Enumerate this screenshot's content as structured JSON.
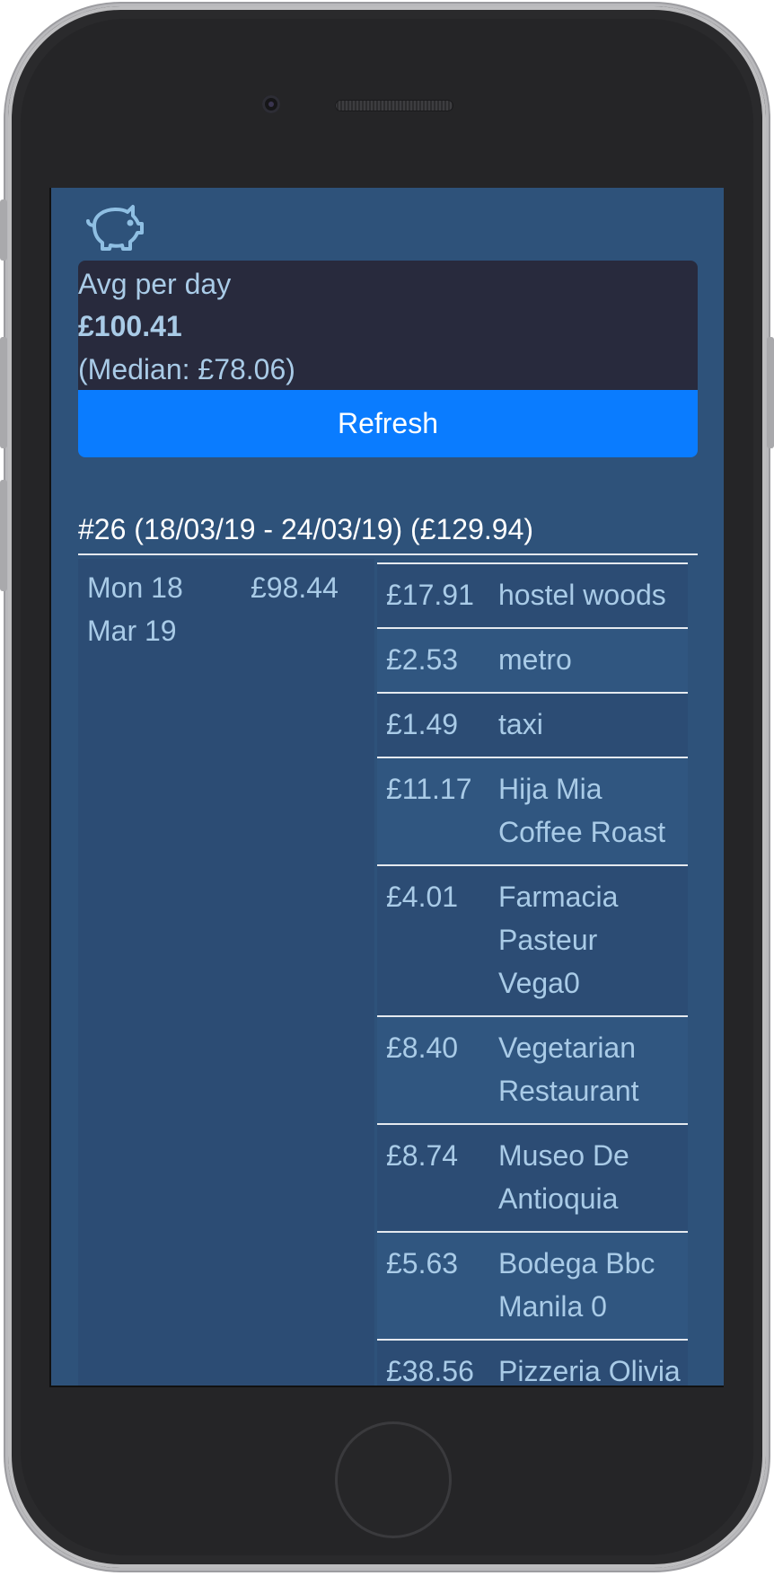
{
  "app": {
    "logo_icon": "piggy-bank-icon"
  },
  "stats": {
    "label": "Avg per day",
    "average": "£100.41",
    "median": "(Median: £78.06)"
  },
  "refresh_label": "Refresh",
  "week": {
    "title": "#26 (18/03/19 - 24/03/19) (£129.94)",
    "day": {
      "date": "Mon 18 Mar 19",
      "total": "£98.44",
      "transactions": [
        {
          "amount": "£17.91",
          "description": "hostel woods"
        },
        {
          "amount": "£2.53",
          "description": "metro"
        },
        {
          "amount": "£1.49",
          "description": "taxi"
        },
        {
          "amount": "£11.17",
          "description": "Hija Mia Coffee Roast"
        },
        {
          "amount": "£4.01",
          "description": "Farmacia Pasteur Vega0"
        },
        {
          "amount": "£8.40",
          "description": "Vegetarian Restaurant"
        },
        {
          "amount": "£8.74",
          "description": "Museo De Antioquia"
        },
        {
          "amount": "£5.63",
          "description": "Bodega Bbc Manila 0"
        },
        {
          "amount": "£38.56",
          "description": "Pizzeria Olivia Manil"
        }
      ]
    }
  },
  "colors": {
    "screen_bg": "#2e527a",
    "stats_bg": "#282a3d",
    "accent": "#0a7cff",
    "text": "#a9cbe7"
  }
}
